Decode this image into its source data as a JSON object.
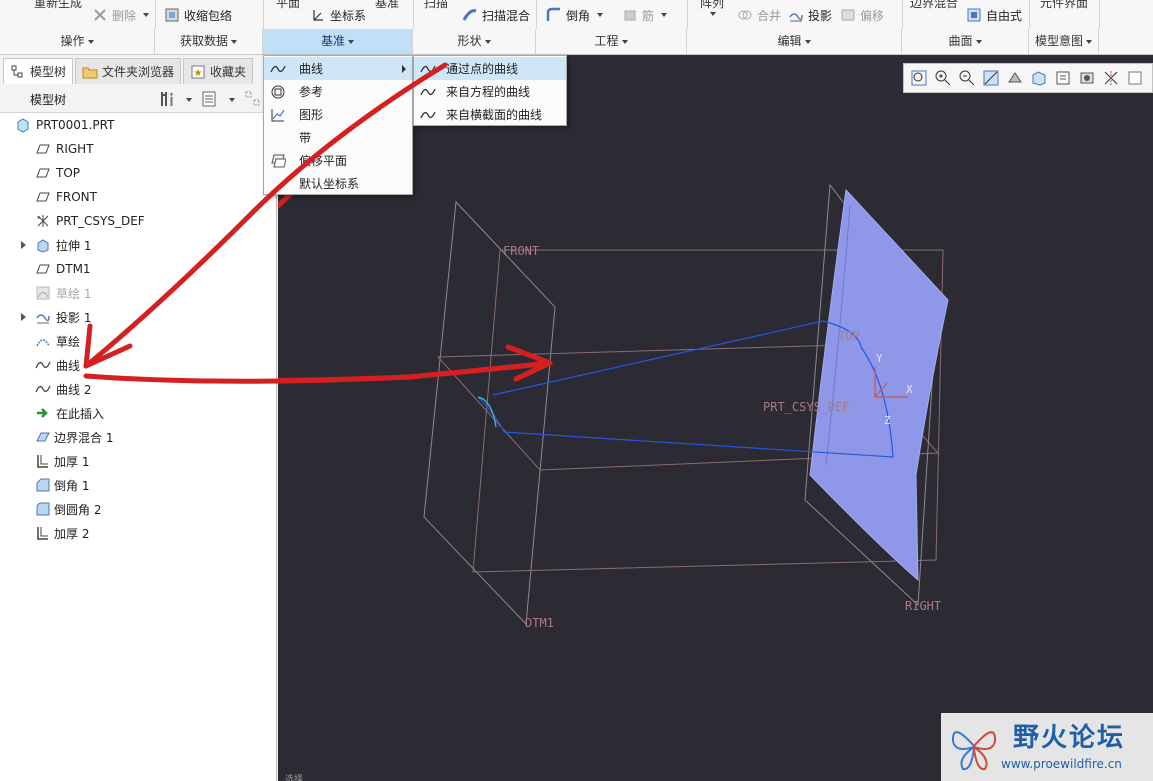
{
  "ribbon": {
    "top_row": {
      "cut_1": "重新生成",
      "delete": "删除",
      "shrinkwrap": "收缩包络",
      "cut_plane": "平面",
      "csys": "坐标系",
      "cut_point": "基准",
      "cut_sweep": "扫描",
      "sweep_blend": "扫描混合",
      "round": "倒角",
      "rib": "筋",
      "cut_pattern": "阵列",
      "merge": "合并",
      "project": "投影",
      "offset": "偏移",
      "cut_boundary": "边界混合",
      "freestyle": "自由式",
      "cut_component": "元件界面"
    },
    "groups": {
      "operations": "操作",
      "get_data": "获取数据",
      "datum": "基准",
      "shapes": "形状",
      "engineering": "工程",
      "editing": "编辑",
      "surfaces": "曲面",
      "model_intent": "模型意图"
    }
  },
  "left_panel": {
    "tabs": [
      "模型树",
      "文件夹浏览器",
      "收藏夹"
    ],
    "tree_title": "模型树",
    "tree": [
      {
        "label": "PRT0001.PRT",
        "icon": "part-icon"
      },
      {
        "label": "RIGHT",
        "icon": "datum-plane-icon"
      },
      {
        "label": "TOP",
        "icon": "datum-plane-icon"
      },
      {
        "label": "FRONT",
        "icon": "datum-plane-icon"
      },
      {
        "label": "PRT_CSYS_DEF",
        "icon": "csys-icon"
      },
      {
        "label": "拉伸 1",
        "icon": "extrude-icon"
      },
      {
        "label": "DTM1",
        "icon": "datum-plane-icon"
      },
      {
        "label": "草绘 1",
        "icon": "sketch-icon"
      },
      {
        "label": "投影 1",
        "icon": "projection-icon"
      },
      {
        "label": "草绘",
        "icon": "sketch-icon"
      },
      {
        "label": "曲线",
        "icon": "curve-icon"
      },
      {
        "label": "曲线 2",
        "icon": "curve-icon"
      },
      {
        "label": "在此插入",
        "icon": "insert-here-arrow-icon"
      },
      {
        "label": "边界混合 1",
        "icon": "boundary-blend-icon"
      },
      {
        "label": "加厚 1",
        "icon": "thicken-icon"
      },
      {
        "label": "倒角 1",
        "icon": "chamfer-icon"
      },
      {
        "label": "倒圆角 2",
        "icon": "round-icon"
      },
      {
        "label": "加厚 2",
        "icon": "thicken-icon"
      }
    ]
  },
  "menus": {
    "datum": [
      {
        "label": "曲线",
        "icon": "curve-icon"
      },
      {
        "label": "参考",
        "icon": "reference-icon"
      },
      {
        "label": "图形",
        "icon": "graph-icon"
      },
      {
        "label": "带",
        "icon": ""
      },
      {
        "label": "偏移平面",
        "icon": "offset-plane-icon"
      },
      {
        "label": "默认坐标系",
        "icon": ""
      }
    ],
    "curve": [
      {
        "label": "通过点的曲线",
        "icon": "curve-icon"
      },
      {
        "label": "来自方程的曲线",
        "icon": "curve-icon"
      },
      {
        "label": "来自横截面的曲线",
        "icon": "curve-icon"
      }
    ]
  },
  "viewport": {
    "labels": {
      "front": "FRONT",
      "top": "TOP",
      "right": "RIGHT",
      "dtm1": "DTM1",
      "csys": "PRT_CSYS_DEF",
      "x": "X",
      "y": "Y",
      "z": "Z"
    }
  },
  "watermark": {
    "name": "野火论坛",
    "url": "www.proewildfire.cn"
  },
  "status": {
    "text": "选择"
  },
  "colors": {
    "viewport_bg": "#2c2b33",
    "surface": "#8f98e8",
    "annotation_arrow": "#d42020",
    "curve": "#1f4fd8",
    "accent": "#bfe0f7"
  }
}
